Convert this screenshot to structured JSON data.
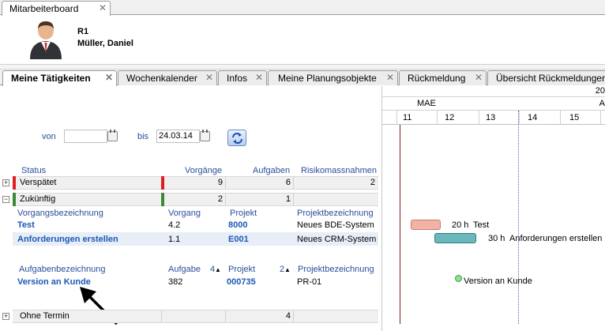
{
  "window_tab": {
    "label": "Mitarbeiterboard"
  },
  "user": {
    "role": "R1",
    "name": "Müller, Daniel"
  },
  "tabs": [
    {
      "label": "Meine Tätigkeiten"
    },
    {
      "label": "Wochenkalender"
    },
    {
      "label": "Infos"
    },
    {
      "label": "Meine Planungsobjekte"
    },
    {
      "label": "Rückmeldung"
    },
    {
      "label": "Übersicht Rückmeldungen"
    }
  ],
  "filter": {
    "from_label": "von",
    "from_value": "",
    "to_label": "bis",
    "to_value": "24.03.14"
  },
  "status_table": {
    "headers": {
      "status": "Status",
      "vorgaenge": "Vorgänge",
      "aufgaben": "Aufgaben",
      "risiko": "Risikomassnahmen"
    },
    "groups": [
      {
        "name": "Verspätet",
        "vorgaenge": "9",
        "aufgaben": "6",
        "risiko": "2",
        "expander": "+",
        "color": "#e02020"
      },
      {
        "name": "Zukünftig",
        "vorgaenge": "2",
        "aufgaben": "1",
        "risiko": "",
        "expander": "−",
        "color": "#3a8a3a"
      },
      {
        "name": "Ohne Termin",
        "vorgaenge": "",
        "aufgaben": "4",
        "risiko": "",
        "expander": "+",
        "color": ""
      }
    ]
  },
  "vorgang_table": {
    "headers": {
      "bez": "Vorgangsbezeichnung",
      "vorgang": "Vorgang",
      "projekt": "Projekt",
      "projbez": "Projektbezeichnung"
    },
    "rows": [
      {
        "bez": "Test",
        "vorgang": "4.2",
        "projekt": "8000",
        "projbez": "Neues BDE-System"
      },
      {
        "bez": "Anforderungen erstellen",
        "vorgang": "1.1",
        "projekt": "E001",
        "projbez": "Neues CRM-System"
      }
    ]
  },
  "aufgaben_table": {
    "headers": {
      "bez": "Aufgabenbezeichnung",
      "aufgabe": "Aufgabe",
      "aufgabe_sort": "4",
      "projekt": "Projekt",
      "projekt_sort": "2",
      "projbez": "Projektbezeichnung"
    },
    "rows": [
      {
        "bez": "Version an Kunde",
        "aufgabe": "382",
        "projekt": "000735",
        "projbez": "PR-01"
      }
    ]
  },
  "gantt": {
    "year_label": "20",
    "week_label": "MAE",
    "week_label_right": "A",
    "days": [
      "11",
      "12",
      "13",
      "14",
      "15"
    ],
    "bars": [
      {
        "hours": "20 h",
        "label": "Test"
      },
      {
        "hours": "30 h",
        "label": "Anforderungen erstellen"
      }
    ],
    "milestone_label": "Version an Kunde"
  },
  "colors": {
    "link": "#1c58b4",
    "header_label": "#2a4e9a",
    "late": "#e02020",
    "future": "#3a8a3a"
  }
}
